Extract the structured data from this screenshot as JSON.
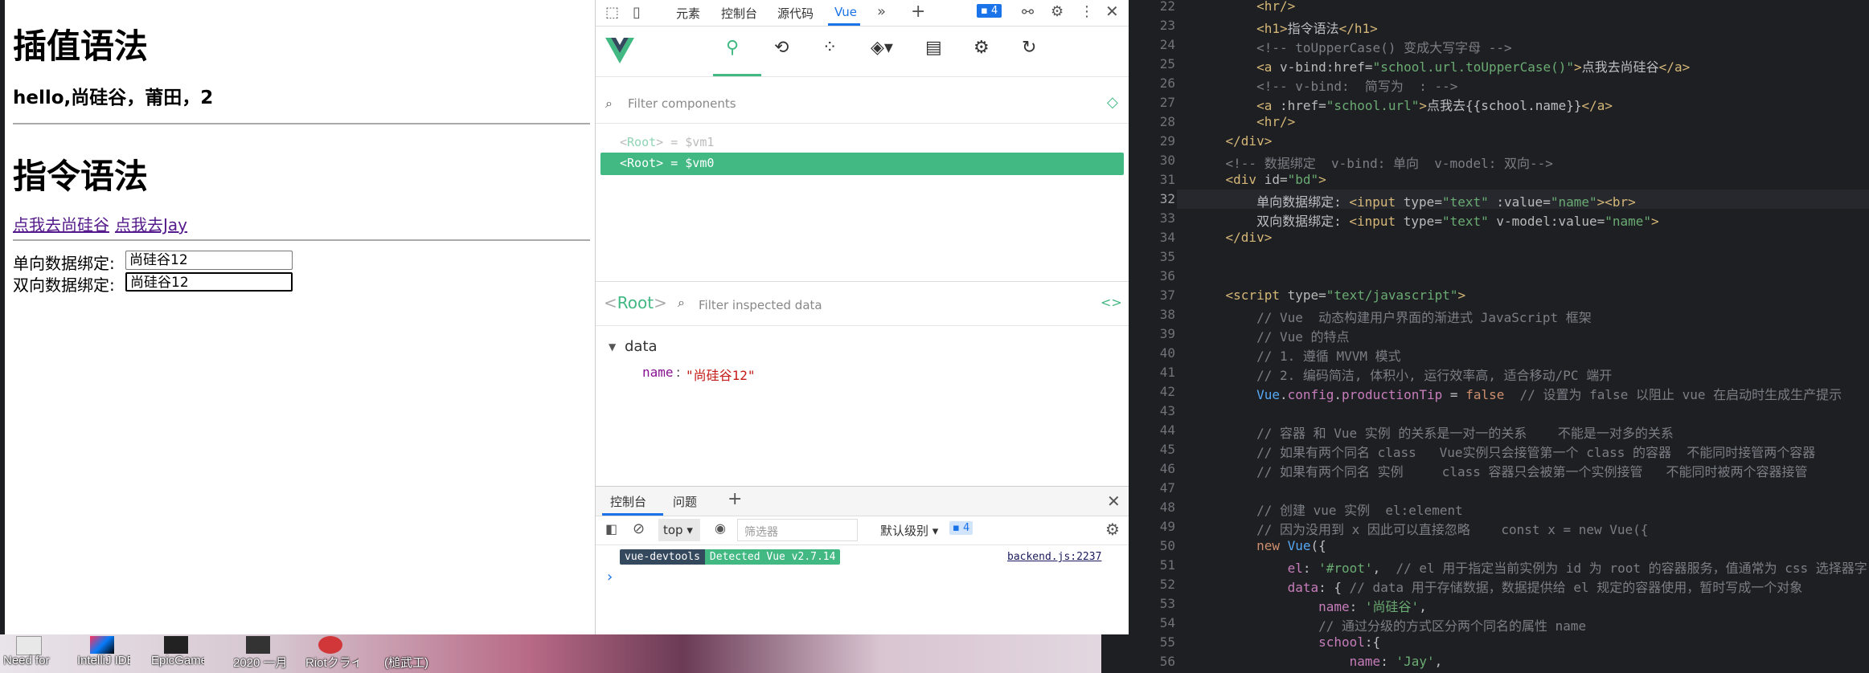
{
  "desktop": {
    "icons": [
      {
        "label": "Need for"
      },
      {
        "label": "IntelliJ IDEA"
      },
      {
        "label": "EpicGame..."
      },
      {
        "label": "2020 一月"
      },
      {
        "label": "Riotクライ"
      },
      {
        "label": "(槌武工)"
      }
    ]
  },
  "page": {
    "h1_interp": "插值语法",
    "hello_text": "hello,尚硅谷，莆田，2",
    "h1_directive": "指令语法",
    "link1": "点我去尚硅谷",
    "link2": "点我去Jay",
    "one_way_label": "单向数据绑定:",
    "one_way_value": "尚硅谷12",
    "two_way_label": "双向数据绑定:",
    "two_way_value": "尚硅谷12"
  },
  "devtools": {
    "tabs": [
      "元素",
      "控制台",
      "源代码",
      "Vue"
    ],
    "badge_count": "4",
    "filter_components_placeholder": "Filter components",
    "components": [
      {
        "tag": "Root",
        "var": "$vm1"
      },
      {
        "tag": "Root",
        "var": "$vm0"
      }
    ],
    "inspect_title": "Root",
    "filter_inspected_placeholder": "Filter inspected data",
    "data_section": "data",
    "data_key": "name",
    "data_value": "\"尚硅谷12\"",
    "console_tabs": [
      "控制台",
      "问题"
    ],
    "context": "top",
    "console_filter_placeholder": "筛选器",
    "level": "默认级别",
    "level_badge": "4",
    "log_tag1": "vue-devtools",
    "log_tag2": "Detected Vue v2.7.14",
    "log_src": "backend.js:2237",
    "prompt": "›"
  },
  "editor": {
    "line_numbers": [
      "22",
      "23",
      "24",
      "25",
      "26",
      "27",
      "28",
      "29",
      "30",
      "31",
      "32",
      "33",
      "34",
      "35",
      "36",
      "37",
      "38",
      "39",
      "40",
      "41",
      "42",
      "43",
      "44",
      "45",
      "46",
      "47",
      "48",
      "49",
      "50",
      "51",
      "52",
      "53",
      "54",
      "55",
      "56"
    ]
  },
  "colors": {
    "vue_green": "#42b883",
    "accent_blue": "#1a73e8",
    "editor_bg": "#1e1f22"
  }
}
